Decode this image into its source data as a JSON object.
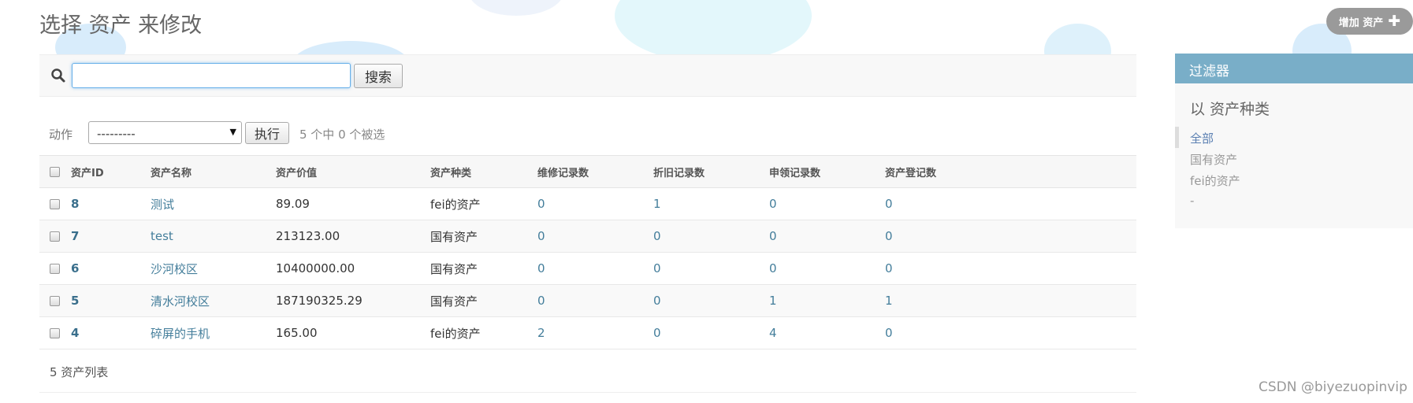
{
  "page": {
    "title": "选择 资产 来修改",
    "add_button_label": "增加 资产",
    "add_button_icon": "plus-icon"
  },
  "search": {
    "value": "",
    "placeholder": "",
    "button_label": "搜索",
    "icon": "search-icon"
  },
  "actions": {
    "label": "动作",
    "selected_option": "---------",
    "run_button_label": "执行",
    "selection_count": "5 个中 0 个被选"
  },
  "table": {
    "columns": [
      "资产ID",
      "资产名称",
      "资产价值",
      "资产种类",
      "维修记录数",
      "折旧记录数",
      "申领记录数",
      "资产登记数"
    ],
    "rows": [
      {
        "id": "8",
        "name": "测试",
        "value": "89.09",
        "kind": "fei的资产",
        "repair": "0",
        "depreciation": "1",
        "claim": "0",
        "register": "0"
      },
      {
        "id": "7",
        "name": "test",
        "value": "213123.00",
        "kind": "国有资产",
        "repair": "0",
        "depreciation": "0",
        "claim": "0",
        "register": "0"
      },
      {
        "id": "6",
        "name": "沙河校区",
        "value": "10400000.00",
        "kind": "国有资产",
        "repair": "0",
        "depreciation": "0",
        "claim": "0",
        "register": "0"
      },
      {
        "id": "5",
        "name": "清水河校区",
        "value": "187190325.29",
        "kind": "国有资产",
        "repair": "0",
        "depreciation": "0",
        "claim": "1",
        "register": "1"
      },
      {
        "id": "4",
        "name": "碎屏的手机",
        "value": "165.00",
        "kind": "fei的资产",
        "repair": "2",
        "depreciation": "0",
        "claim": "4",
        "register": "0"
      }
    ],
    "footer_count": "5 资产列表"
  },
  "filter": {
    "title": "过滤器",
    "subtitle": "以 资产种类",
    "options": [
      "全部",
      "国有资产",
      "fei的资产",
      "-"
    ],
    "selected_option": "全部"
  },
  "watermark": "CSDN @biyezuopinvip",
  "colors": {
    "link": "#447e9b",
    "filter_header": "#79aec8",
    "selected_filter": "#5b80b2"
  }
}
